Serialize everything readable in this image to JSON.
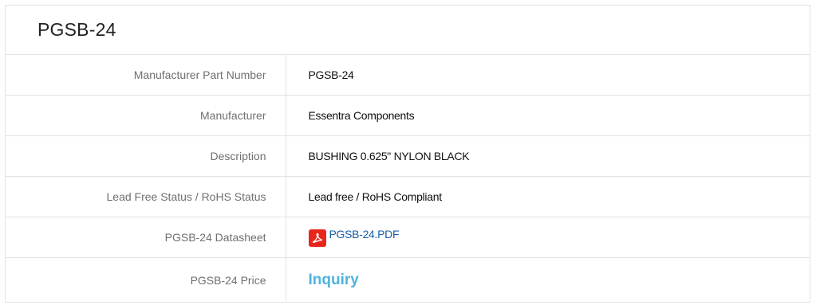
{
  "panel": {
    "title": "PGSB-24"
  },
  "rows": [
    {
      "label": "Manufacturer Part Number",
      "value": "PGSB-24"
    },
    {
      "label": "Manufacturer",
      "value": "Essentra Components"
    },
    {
      "label": "Description",
      "value": "BUSHING 0.625\" NYLON BLACK"
    },
    {
      "label": "Lead Free Status / RoHS Status",
      "value": "Lead free / RoHS Compliant"
    },
    {
      "label": "PGSB-24 Datasheet",
      "value": "PGSB-24.PDF",
      "icon": "pdf-icon"
    },
    {
      "label": "PGSB-24 Price",
      "value": "Inquiry"
    }
  ],
  "colors": {
    "link": "#1a5ea8",
    "inquiry": "#4fb3dd",
    "pdf_icon": "#e9261c"
  }
}
